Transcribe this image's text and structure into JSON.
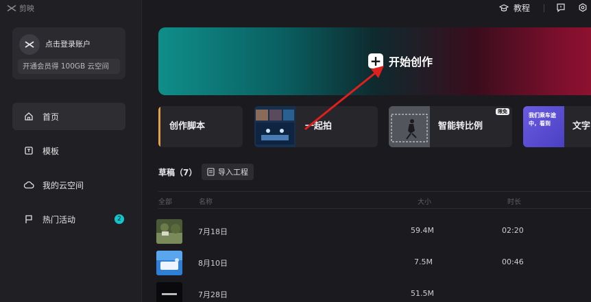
{
  "app": {
    "name": "剪映"
  },
  "account": {
    "login_label": "点击登录账户",
    "vip_promo": "开通会员得 100GB 云空间"
  },
  "nav": [
    {
      "label": "首页",
      "icon": "home-icon",
      "active": true
    },
    {
      "label": "模板",
      "icon": "template-icon",
      "active": false
    },
    {
      "label": "我的云空间",
      "icon": "cloud-icon",
      "active": false
    },
    {
      "label": "热门活动",
      "icon": "flag-icon",
      "active": false,
      "badge": "2"
    }
  ],
  "topbar": {
    "tutorial_label": "教程"
  },
  "hero": {
    "label": "开始创作"
  },
  "cards": [
    {
      "label": "创作脚本"
    },
    {
      "label": "一起拍"
    },
    {
      "label": "智能转比例",
      "pill": "限免"
    },
    {
      "label": "文字",
      "thumb_text": "我们乘车途中，看到"
    }
  ],
  "drafts": {
    "title": "草稿（7）",
    "import_label": "导入工程",
    "columns": {
      "all": "全部",
      "name": "名称",
      "size": "大小",
      "duration": "时长"
    },
    "rows": [
      {
        "name": "7月18日",
        "size": "59.4M",
        "duration": "02:20"
      },
      {
        "name": "8月10日",
        "size": "7.5M",
        "duration": "00:46"
      },
      {
        "name": "7月28日",
        "size": "51.5M",
        "duration": ""
      }
    ]
  },
  "colors": {
    "accent_teal": "#13c5c8",
    "card_accent": "#e3a24a",
    "arrow": "#e0201e"
  }
}
